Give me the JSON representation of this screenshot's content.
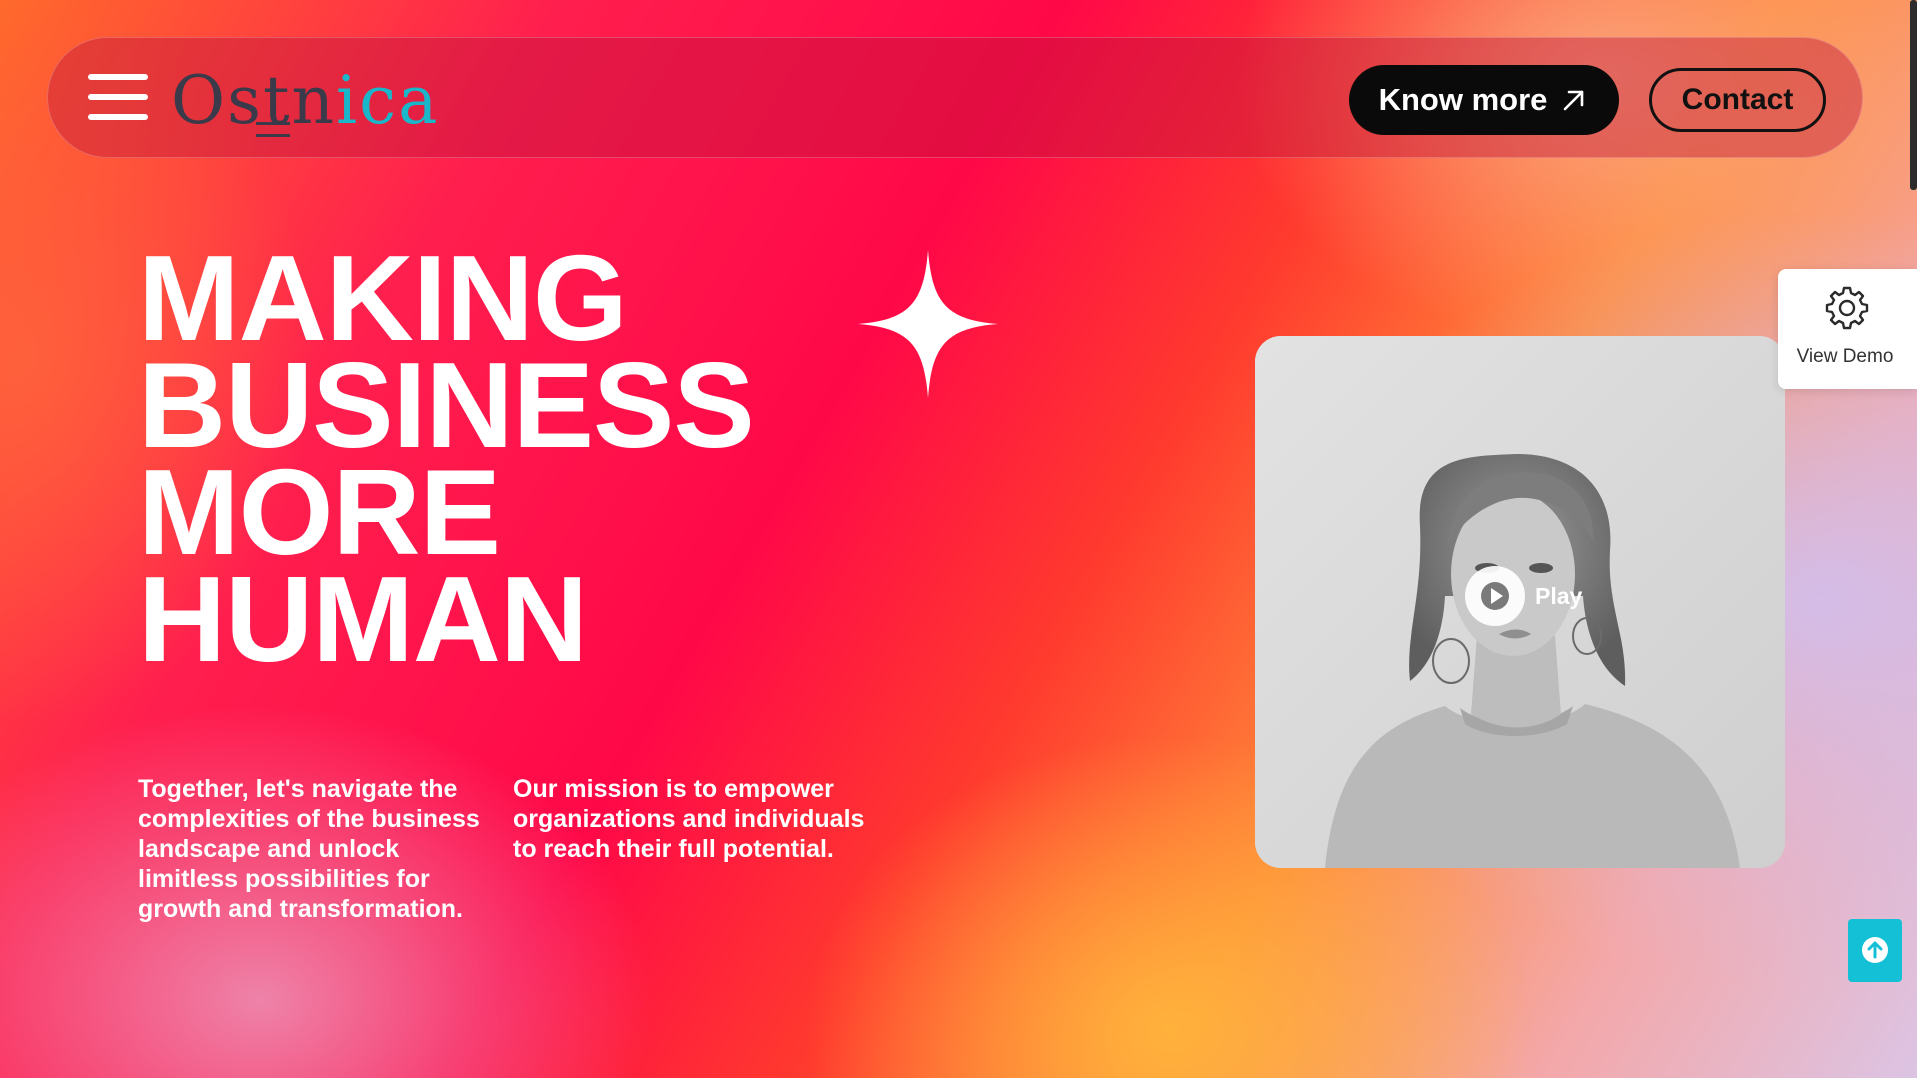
{
  "header": {
    "logo_part1": "Ostn",
    "logo_part2": "ica",
    "know_more_label": "Know more",
    "contact_label": "Contact"
  },
  "hero": {
    "title_lines": [
      "MAKING",
      "BUSINESS",
      "MORE",
      "HUMAN"
    ],
    "paragraph_left": "Together, let's navigate the complexities of the business landscape and unlock limitless possibilities for growth and transformation.",
    "paragraph_right": "Our mission is to empower organizations and individuals to reach their full potential."
  },
  "video": {
    "play_label": "Play"
  },
  "side_panel": {
    "view_demo_label": "View Demo"
  },
  "icons": {
    "menu": "hamburger-menu-icon",
    "arrow": "arrow-up-right-icon",
    "sparkle": "four-point-star-icon",
    "play": "play-icon",
    "settings": "gear-icon",
    "back_to_top": "arrow-up-circle-icon"
  },
  "colors": {
    "brand_teal": "#19b7c9",
    "logo_dark": "#3a3a4a",
    "primary_button": "#0a0a0a",
    "back_to_top": "#14c0d6",
    "hero_text": "#ffffff"
  }
}
